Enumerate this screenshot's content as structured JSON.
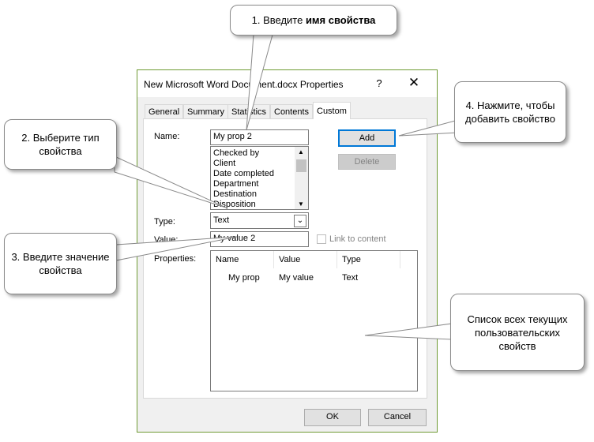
{
  "dialog": {
    "title": "New Microsoft Word Document.docx Properties",
    "help_label": "?",
    "close_label": "✕",
    "tabs": [
      "General",
      "Summary",
      "Statistics",
      "Contents",
      "Custom"
    ],
    "active_tab": "Custom",
    "name_label": "Name:",
    "name_value": "My prop 2",
    "name_list": [
      "Checked by",
      "Client",
      "Date completed",
      "Department",
      "Destination",
      "Disposition"
    ],
    "type_label": "Type:",
    "type_value": "Text",
    "value_label": "Value:",
    "value_value": "My value 2",
    "link_label": "Link to content",
    "properties_label": "Properties:",
    "add_label": "Add",
    "delete_label": "Delete",
    "columns": [
      "Name",
      "Value",
      "Type"
    ],
    "properties": [
      {
        "name": "My prop",
        "value": "My value",
        "type": "Text"
      }
    ],
    "ok_label": "OK",
    "cancel_label": "Cancel"
  },
  "callouts": {
    "c1_text": "1. Введите ",
    "c1_bold": "имя свойства",
    "c2": "2. Выберите тип свойства",
    "c3": "3. Введите значение свойства",
    "c4": "4. Нажмите, чтобы добавить свойство",
    "c5": "Список всех текущих пользовательских свойств"
  },
  "colors": {
    "dialog_border": "#6f9b34",
    "default_button_border": "#0078d7"
  }
}
